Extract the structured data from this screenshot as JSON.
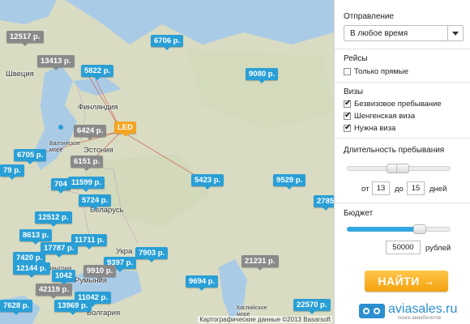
{
  "map": {
    "regions": [
      {
        "id": "sweden",
        "label": "Швеция"
      },
      {
        "id": "finland",
        "label": "Финляндия"
      },
      {
        "id": "baltic",
        "label": "Балтийское море"
      },
      {
        "id": "estonia",
        "label": "Эстония"
      },
      {
        "id": "belarus",
        "label": "Беларусь"
      },
      {
        "id": "ukraine",
        "label": "Укра"
      },
      {
        "id": "hungary",
        "label": "Венгрия"
      },
      {
        "id": "romania",
        "label": "Румыния"
      },
      {
        "id": "bulgaria",
        "label": "Болгария"
      },
      {
        "id": "caspian",
        "label": "Каспийское море"
      }
    ],
    "origin_label": "LED",
    "prices": [
      {
        "id": "p12517",
        "label": "12517 р.",
        "color": "gray"
      },
      {
        "id": "p6706",
        "label": "6706 р.",
        "color": "blue"
      },
      {
        "id": "p13413",
        "label": "13413 р.",
        "color": "gray"
      },
      {
        "id": "p5822",
        "label": "5822 р.",
        "color": "blue"
      },
      {
        "id": "p9080",
        "label": "9080 р.",
        "color": "blue"
      },
      {
        "id": "p6424",
        "label": "6424 р.",
        "color": "gray"
      },
      {
        "id": "p6705",
        "label": "6705 р.",
        "color": "blue"
      },
      {
        "id": "p6151",
        "label": "6151 р.",
        "color": "gray"
      },
      {
        "id": "p79",
        "label": "79 р.",
        "color": "blue"
      },
      {
        "id": "p704",
        "label": "704",
        "color": "blue"
      },
      {
        "id": "p11599",
        "label": "11599 р.",
        "color": "blue"
      },
      {
        "id": "p5423",
        "label": "5423 р.",
        "color": "blue"
      },
      {
        "id": "p9529",
        "label": "9529 р.",
        "color": "blue"
      },
      {
        "id": "p2785",
        "label": "2785",
        "color": "blue"
      },
      {
        "id": "p5724",
        "label": "5724 р.",
        "color": "blue"
      },
      {
        "id": "p12512",
        "label": "12512 р.",
        "color": "blue"
      },
      {
        "id": "p8613",
        "label": "8613 р.",
        "color": "blue"
      },
      {
        "id": "p11711",
        "label": "11711 р.",
        "color": "blue"
      },
      {
        "id": "p17787",
        "label": "17787 р.",
        "color": "blue"
      },
      {
        "id": "p7420",
        "label": "7420 р.",
        "color": "blue"
      },
      {
        "id": "p7903",
        "label": "7903 р.",
        "color": "blue"
      },
      {
        "id": "p9397",
        "label": "9397 р.",
        "color": "blue"
      },
      {
        "id": "p12144",
        "label": "12144 р.",
        "color": "blue"
      },
      {
        "id": "p21231",
        "label": "21231 р.",
        "color": "gray"
      },
      {
        "id": "p9910",
        "label": "9910 р.",
        "color": "gray"
      },
      {
        "id": "p9694",
        "label": "9694 р.",
        "color": "blue"
      },
      {
        "id": "p1042",
        "label": "1042",
        "color": "blue"
      },
      {
        "id": "p11042",
        "label": "11042 р.",
        "color": "blue"
      },
      {
        "id": "p42119",
        "label": "42119 р.",
        "color": "gray"
      },
      {
        "id": "p7628",
        "label": "7628 р.",
        "color": "blue"
      },
      {
        "id": "p13969",
        "label": "13969 р.",
        "color": "blue"
      },
      {
        "id": "p22570",
        "label": "22570 р.",
        "color": "blue"
      }
    ],
    "copyright": "Картографические данные ©2013 Basarsoft"
  },
  "panel": {
    "departure": {
      "title": "Отправление",
      "value": "В любое время"
    },
    "flights": {
      "title": "Рейсы",
      "direct_label": "Только прямые",
      "direct_checked": false
    },
    "visas": {
      "title": "Визы",
      "options": [
        {
          "label": "Безвизовое пребывание",
          "checked": true
        },
        {
          "label": "Шенгенская виза",
          "checked": true
        },
        {
          "label": "Нужна виза",
          "checked": true
        }
      ]
    },
    "duration": {
      "title": "Длительность пребывания",
      "from_label": "от",
      "from_value": "13",
      "to_label": "до",
      "to_value": "15",
      "unit": "дней"
    },
    "budget": {
      "title": "Бюджет",
      "value": "50000",
      "unit": "рублей",
      "level": 0.7
    },
    "search_button": "НАЙТИ →",
    "logo": {
      "name": "aviasales.ru",
      "tagline": "поиск авиабилетов"
    }
  },
  "colors": {
    "price_blue": "#2a9fd6",
    "price_gray": "#8a8a8a",
    "origin_orange": "#f4a423",
    "button": "#f4a20e"
  }
}
